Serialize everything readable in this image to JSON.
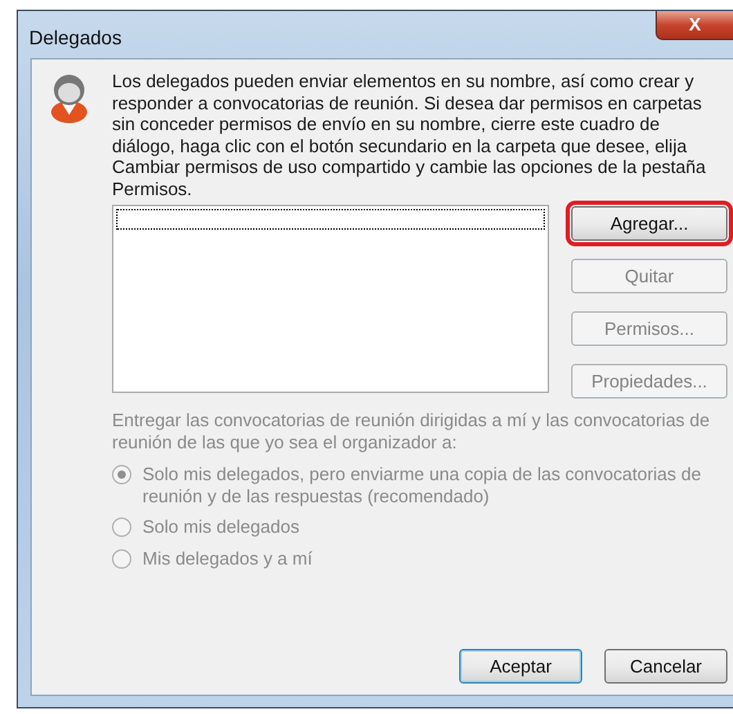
{
  "window": {
    "title": "Delegados",
    "close": "X"
  },
  "description": "Los delegados pueden enviar elementos en su nombre, así como crear y responder a convocatorias de reunión. Si desea dar permisos en carpetas sin conceder permisos de envío en su nombre, cierre este cuadro de diálogo, haga clic con el botón secundario en la carpeta que desee, elija Cambiar permisos de uso compartido y cambie las opciones de la pestaña Permisos.",
  "side_buttons": [
    {
      "label": "Agregar...",
      "disabled": false,
      "highlighted": true
    },
    {
      "label": "Quitar",
      "disabled": true,
      "highlighted": false
    },
    {
      "label": "Permisos...",
      "disabled": true,
      "highlighted": false
    },
    {
      "label": "Propiedades...",
      "disabled": true,
      "highlighted": false
    }
  ],
  "delivery": {
    "label": "Entregar las convocatorias de reunión dirigidas a mí y las convocatorias de reunión de las que yo sea el organizador a:",
    "disabled": true,
    "options": [
      {
        "label": "Solo mis delegados, pero enviarme una copia de las convocatorias de reunión y de las respuestas (recomendado)",
        "selected": true
      },
      {
        "label": "Solo mis delegados",
        "selected": false
      },
      {
        "label": "Mis delegados y a mí",
        "selected": false
      }
    ]
  },
  "footer_buttons": [
    {
      "label": "Aceptar",
      "default": true
    },
    {
      "label": "Cancelar",
      "default": false
    }
  ]
}
